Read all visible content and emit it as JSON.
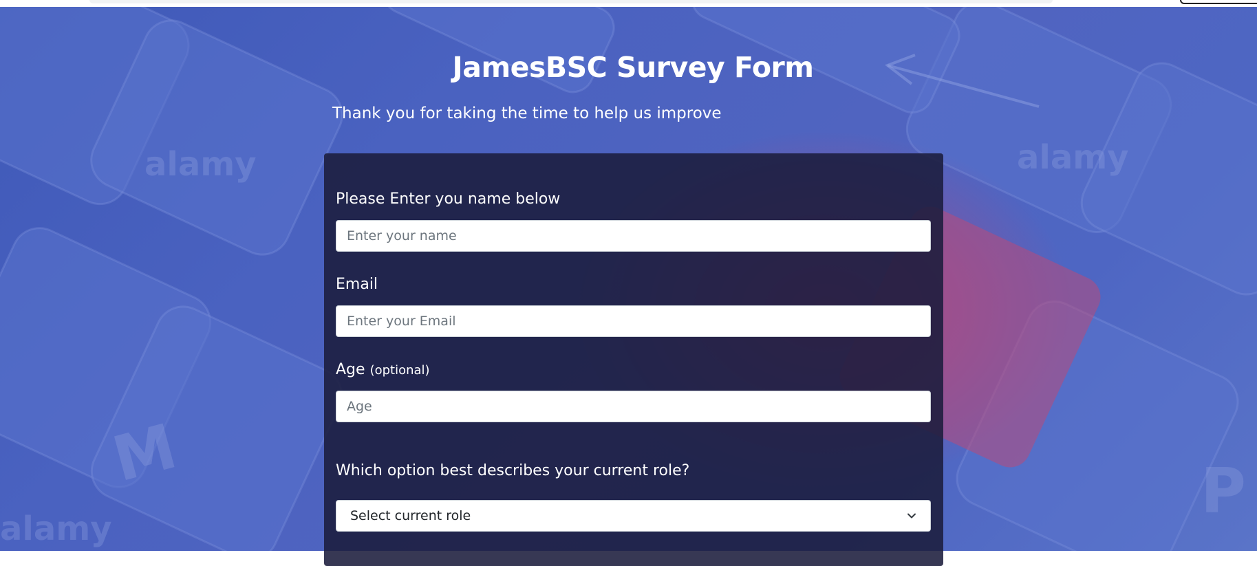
{
  "page": {
    "title": "JamesBSC Survey Form",
    "description": "Thank you for taking the time to help us improve"
  },
  "form": {
    "name": {
      "label": "Please Enter you name below",
      "placeholder": "Enter your name",
      "value": ""
    },
    "email": {
      "label": "Email",
      "placeholder": "Enter your Email",
      "value": ""
    },
    "age": {
      "label": "Age",
      "optional_note": "(optional)",
      "placeholder": "Age",
      "value": ""
    },
    "role": {
      "label": "Which option best describes your current role?",
      "selected": "Select current role"
    }
  },
  "icons": {
    "dropdown": "chevron-down-icon"
  },
  "colors": {
    "background": "#4a62c0",
    "card": "#1b1c3c",
    "text": "#ffffff",
    "input_bg": "#ffffff",
    "placeholder": "#6c757d"
  }
}
